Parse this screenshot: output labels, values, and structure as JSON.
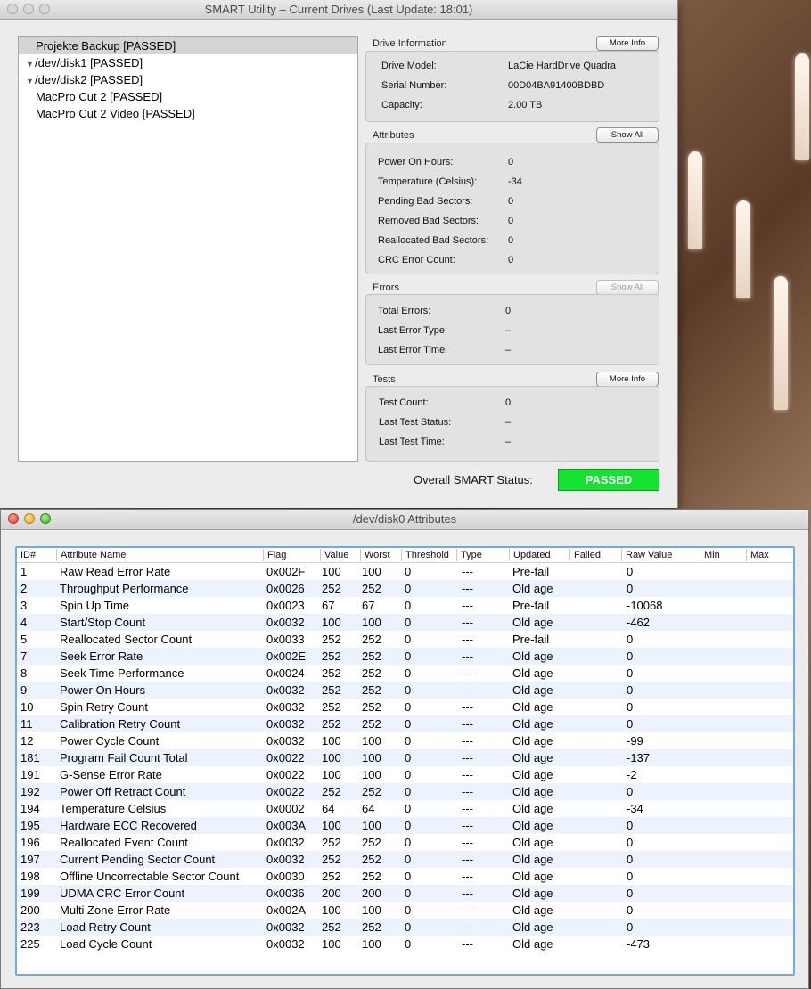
{
  "window1": {
    "title": "SMART Utility – Current Drives (Last Update: 18:01)",
    "drives": [
      {
        "label": "Projekte Backup  [PASSED]",
        "expander": false,
        "selected": true
      },
      {
        "label": "/dev/disk1  [PASSED]",
        "expander": true,
        "selected": false
      },
      {
        "label": "/dev/disk2  [PASSED]",
        "expander": true,
        "selected": false
      },
      {
        "label": "MacPro Cut 2  [PASSED]",
        "expander": false,
        "selected": false
      },
      {
        "label": "MacPro Cut 2 Video  [PASSED]",
        "expander": false,
        "selected": false
      }
    ],
    "drive_info": {
      "heading": "Drive Information",
      "button": "More Info",
      "rows": [
        {
          "label": "Drive Model:",
          "value": "LaCie   HardDrive Quadra"
        },
        {
          "label": "Serial Number:",
          "value": "00D04BA91400BDBD"
        },
        {
          "label": "Capacity:",
          "value": "2.00 TB"
        }
      ]
    },
    "attributes": {
      "heading": "Attributes",
      "button": "Show All",
      "rows": [
        {
          "label": "Power On Hours:",
          "value": "0"
        },
        {
          "label": "Temperature (Celsius):",
          "value": "-34"
        },
        {
          "label": "Pending Bad Sectors:",
          "value": "0"
        },
        {
          "label": "Removed Bad Sectors:",
          "value": "0"
        },
        {
          "label": "Reallocated Bad Sectors:",
          "value": "0"
        },
        {
          "label": "CRC Error Count:",
          "value": "0"
        }
      ]
    },
    "errors": {
      "heading": "Errors",
      "button": "Show All",
      "rows": [
        {
          "label": "Total Errors:",
          "value": "0"
        },
        {
          "label": "Last Error Type:",
          "value": "–"
        },
        {
          "label": "Last Error Time:",
          "value": "–"
        }
      ]
    },
    "tests": {
      "heading": "Tests",
      "button": "More Info",
      "rows": [
        {
          "label": "Test Count:",
          "value": "0"
        },
        {
          "label": "Last Test Status:",
          "value": "–"
        },
        {
          "label": "Last Test Time:",
          "value": "–"
        }
      ]
    },
    "overall": {
      "label": "Overall SMART Status:",
      "value": "PASSED",
      "color": "#14e332"
    }
  },
  "window2": {
    "title": "/dev/disk0 Attributes",
    "columns": [
      "ID#",
      "Attribute Name",
      "Flag",
      "Value",
      "Worst",
      "Threshold",
      "Type",
      "Updated",
      "Failed",
      "Raw Value",
      "Min",
      "Max"
    ],
    "rows": [
      [
        "1",
        "Raw Read Error Rate",
        "0x002F",
        "100",
        "100",
        "0",
        "---",
        "Pre-fail",
        "",
        "0"
      ],
      [
        "2",
        "Throughput Performance",
        "0x0026",
        "252",
        "252",
        "0",
        "---",
        "Old age",
        "",
        "0"
      ],
      [
        "3",
        "Spin Up Time",
        "0x0023",
        "67",
        "67",
        "0",
        "---",
        "Pre-fail",
        "",
        "-10068"
      ],
      [
        "4",
        "Start/Stop Count",
        "0x0032",
        "100",
        "100",
        "0",
        "---",
        "Old age",
        "",
        "-462"
      ],
      [
        "5",
        "Reallocated Sector Count",
        "0x0033",
        "252",
        "252",
        "0",
        "---",
        "Pre-fail",
        "",
        "0"
      ],
      [
        "7",
        "Seek Error Rate",
        "0x002E",
        "252",
        "252",
        "0",
        "---",
        "Old age",
        "",
        "0"
      ],
      [
        "8",
        "Seek Time Performance",
        "0x0024",
        "252",
        "252",
        "0",
        "---",
        "Old age",
        "",
        "0"
      ],
      [
        "9",
        "Power On Hours",
        "0x0032",
        "252",
        "252",
        "0",
        "---",
        "Old age",
        "",
        "0"
      ],
      [
        "10",
        "Spin Retry Count",
        "0x0032",
        "252",
        "252",
        "0",
        "---",
        "Old age",
        "",
        "0"
      ],
      [
        "11",
        "Calibration Retry Count",
        "0x0032",
        "252",
        "252",
        "0",
        "---",
        "Old age",
        "",
        "0"
      ],
      [
        "12",
        "Power Cycle Count",
        "0x0032",
        "100",
        "100",
        "0",
        "---",
        "Old age",
        "",
        "-99"
      ],
      [
        "181",
        "Program Fail Count Total",
        "0x0022",
        "100",
        "100",
        "0",
        "---",
        "Old age",
        "",
        "-137"
      ],
      [
        "191",
        "G-Sense Error Rate",
        "0x0022",
        "100",
        "100",
        "0",
        "---",
        "Old age",
        "",
        "-2"
      ],
      [
        "192",
        "Power Off Retract Count",
        "0x0022",
        "252",
        "252",
        "0",
        "---",
        "Old age",
        "",
        "0"
      ],
      [
        "194",
        "Temperature Celsius",
        "0x0002",
        "64",
        "64",
        "0",
        "---",
        "Old age",
        "",
        "-34"
      ],
      [
        "195",
        "Hardware ECC Recovered",
        "0x003A",
        "100",
        "100",
        "0",
        "---",
        "Old age",
        "",
        "0"
      ],
      [
        "196",
        "Reallocated Event Count",
        "0x0032",
        "252",
        "252",
        "0",
        "---",
        "Old age",
        "",
        "0"
      ],
      [
        "197",
        "Current Pending Sector Count",
        "0x0032",
        "252",
        "252",
        "0",
        "---",
        "Old age",
        "",
        "0"
      ],
      [
        "198",
        "Offline Uncorrectable Sector Count",
        "0x0030",
        "252",
        "252",
        "0",
        "---",
        "Old age",
        "",
        "0"
      ],
      [
        "199",
        "UDMA CRC Error Count",
        "0x0036",
        "200",
        "200",
        "0",
        "---",
        "Old age",
        "",
        "0"
      ],
      [
        "200",
        "Multi Zone Error Rate",
        "0x002A",
        "100",
        "100",
        "0",
        "---",
        "Old age",
        "",
        "0"
      ],
      [
        "223",
        "Load Retry Count",
        "0x0032",
        "252",
        "252",
        "0",
        "---",
        "Old age",
        "",
        "0"
      ],
      [
        "225",
        "Load Cycle Count",
        "0x0032",
        "100",
        "100",
        "0",
        "---",
        "Old age",
        "",
        "-473"
      ]
    ]
  }
}
